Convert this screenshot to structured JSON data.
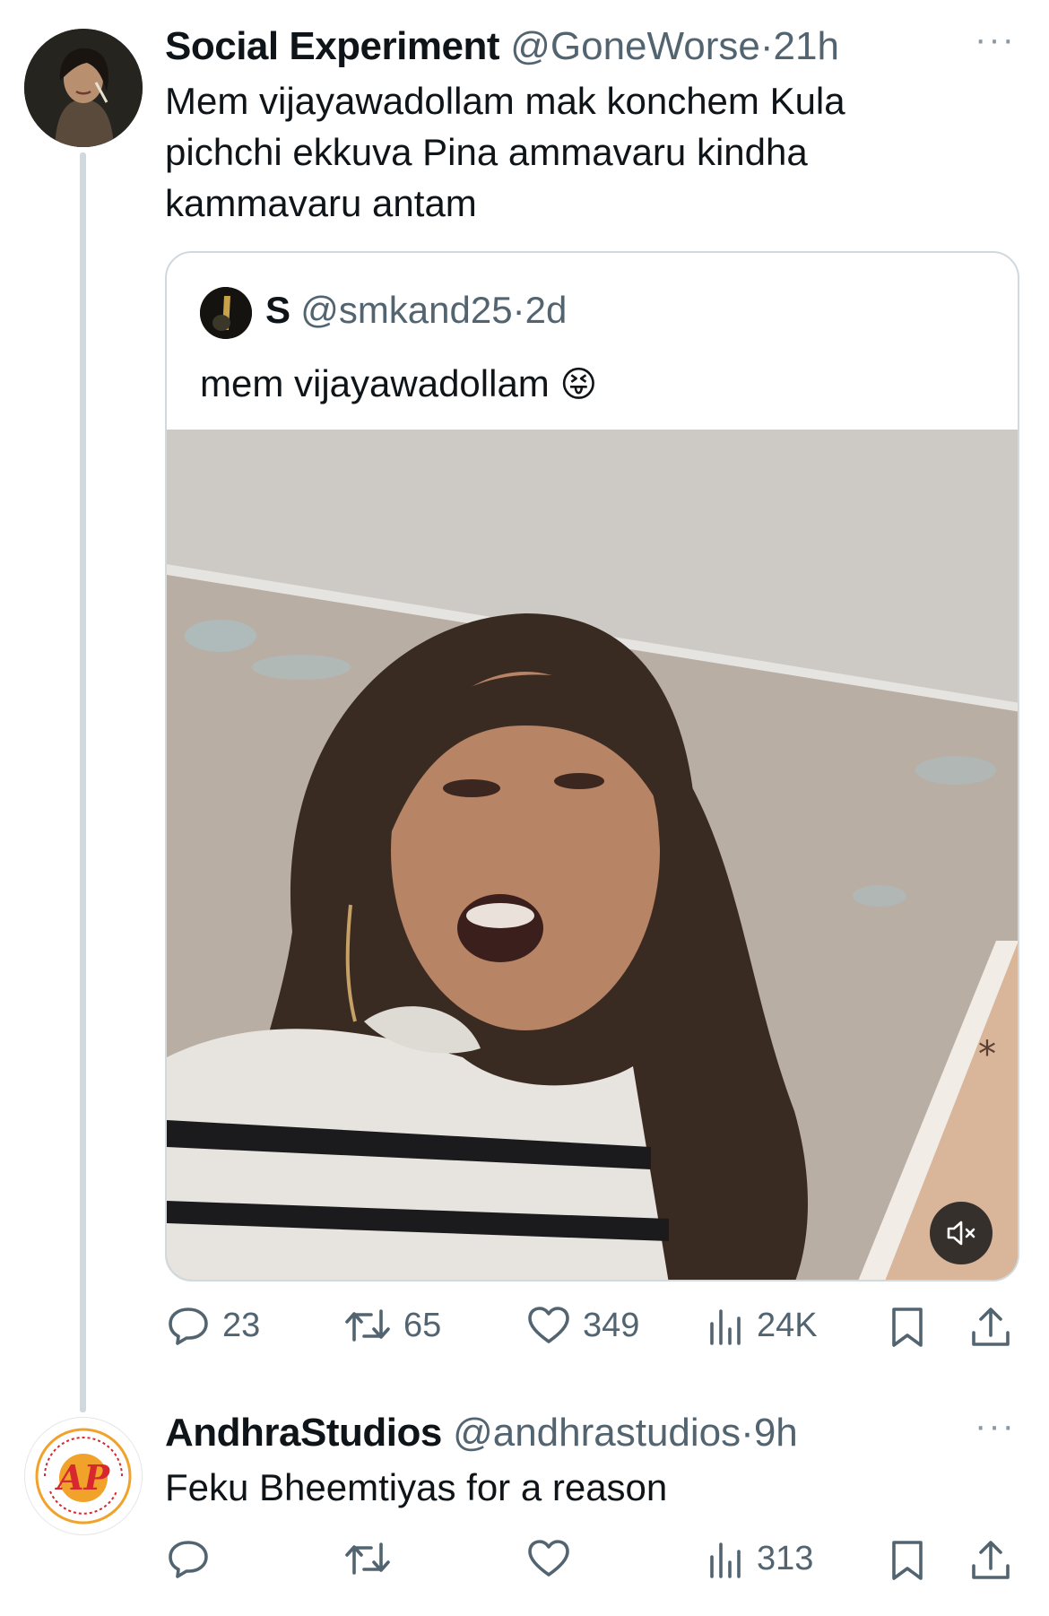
{
  "tweet1": {
    "display_name": "Social Experiment",
    "handle": "@GoneWorse",
    "time": "21h",
    "more": "···",
    "text_lines": [
      "Mem vijayawadollam mak konchem Kula",
      "pichchi ekkuva Pina ammavaru kindha",
      "kammavaru antam"
    ],
    "quote": {
      "display_name": "S",
      "handle": "@smkand25",
      "time": "2d",
      "text": "mem vijayawadollam",
      "emoji": "😝"
    },
    "stats": {
      "replies": "23",
      "reposts": "65",
      "likes": "349",
      "views": "24K"
    }
  },
  "tweet2": {
    "display_name": "AndhraStudios",
    "handle": "@andhrastudios",
    "time": "9h",
    "more": "···",
    "text": "Feku Bheemtiyas for a reason",
    "stats": {
      "replies": "",
      "reposts": "",
      "likes": "",
      "views": "313"
    }
  },
  "separator": "·",
  "colors": {
    "text": "#0f1419",
    "muted": "#536471",
    "border": "#cfd9de",
    "logo_red": "#d6282e",
    "logo_orange": "#f0a22a"
  }
}
